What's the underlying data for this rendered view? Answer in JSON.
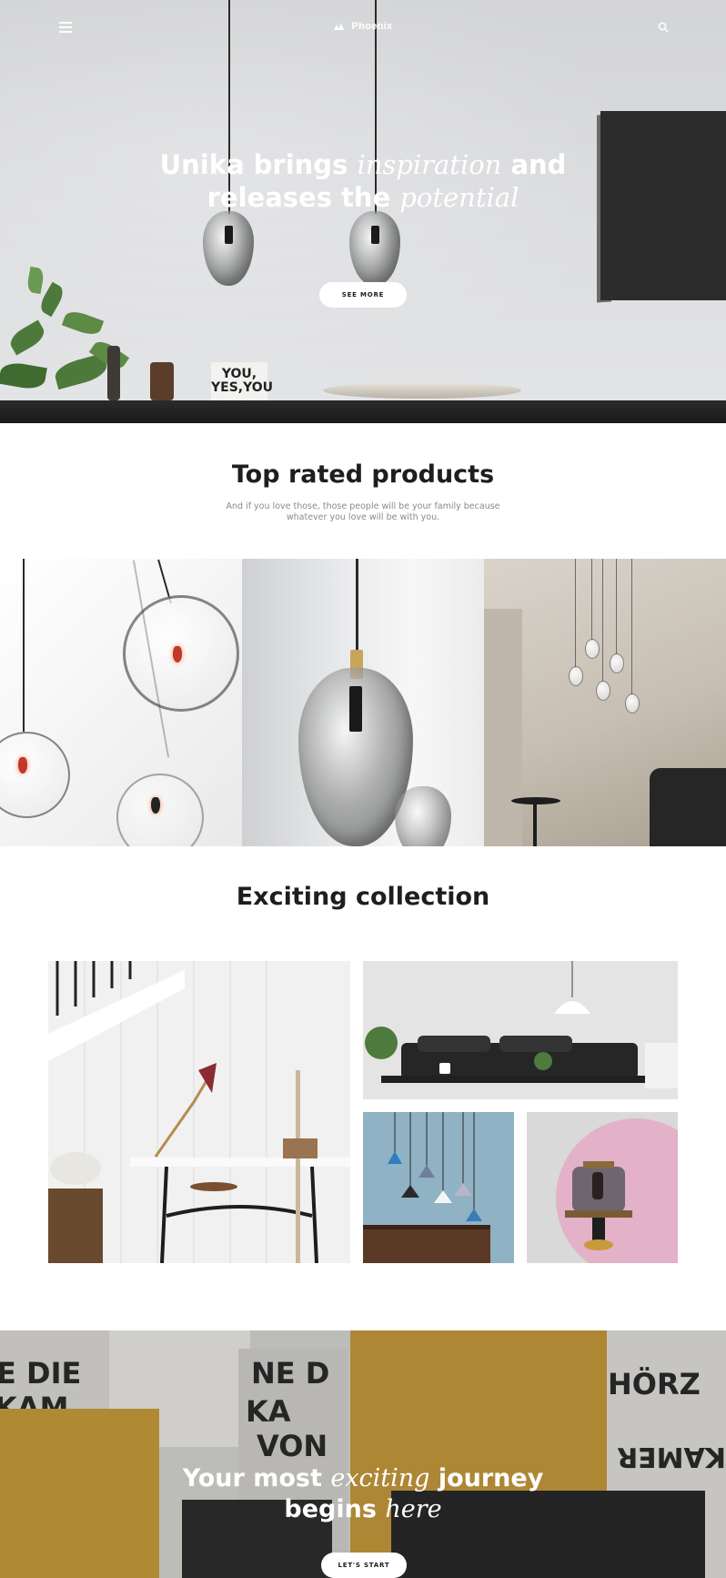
{
  "header": {
    "brand": "Phoenix",
    "menu_icon": "hamburger-menu-icon",
    "search_icon": "search-icon"
  },
  "hero": {
    "title_part1": "Unika brings ",
    "title_em1": "inspiration",
    "title_part2": " and",
    "title_part3": "releases the ",
    "title_em2": "potential",
    "cta": "SEE MORE",
    "sign_line1": "YOU,",
    "sign_line2": "YES,YOU"
  },
  "top_rated": {
    "title": "Top rated products",
    "subtitle": "And if you love those, those people will be your family because whatever you love will be with you."
  },
  "collection": {
    "title": "Exciting collection"
  },
  "banner": {
    "title_part1": "Your most ",
    "title_em1": "exciting",
    "title_part2": " journey",
    "title_part3": "begins ",
    "title_em2": "here",
    "cta": "LET'S START",
    "poster_words": [
      "E DIE",
      "KAM",
      "NE D",
      "KA",
      "VON",
      "HÖRZ",
      "KAMER"
    ]
  },
  "colors": {
    "accent_gold": "#c79a3a",
    "dark": "#1e1e1e",
    "pink": "#e3b1c8",
    "blue": "#8fb2c4"
  }
}
